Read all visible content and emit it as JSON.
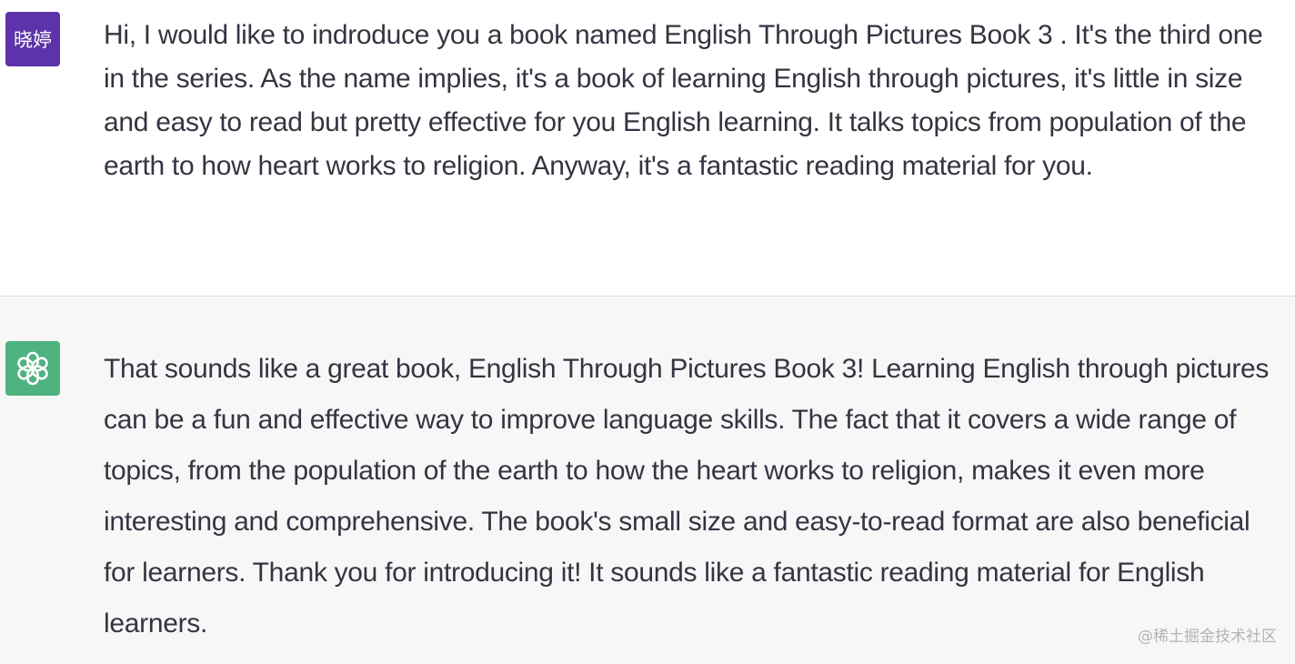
{
  "conversation": {
    "user_message": {
      "avatar_label": "晓婷",
      "avatar_color": "#5c33a8",
      "text": "Hi, I would like to indroduce you a book named English Through Pictures Book 3 . It's the third one in the series. As the name implies, it's a book of learning English through pictures, it's little in size and easy to read but pretty effective for you English learning. It talks topics from population of the earth to how heart works to religion. Anyway, it's a fantastic reading material for you."
    },
    "assistant_message": {
      "avatar_icon": "openai-logo-icon",
      "avatar_color": "#4fb37f",
      "text": "That sounds like a great book, English Through Pictures Book 3! Learning English through pictures can be a fun and effective way to improve language skills. The fact that it covers a wide range of topics, from the population of the earth to how the heart works to religion, makes it even more interesting and comprehensive. The book's small size and easy-to-read format are also beneficial for learners. Thank you for introducing it! It sounds like a fantastic reading material for English learners."
    }
  },
  "watermark": "@稀土掘金技术社区",
  "colors": {
    "text": "#343541",
    "assistant_bg": "#f7f7f8",
    "divider": "#d9d9e3"
  }
}
